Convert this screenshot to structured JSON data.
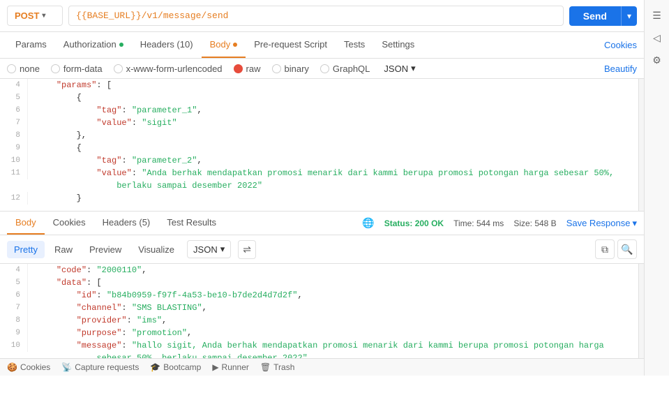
{
  "method": "POST",
  "url": "{{BASE_URL}}/v1/message/send",
  "send_label": "Send",
  "tabs": {
    "params": "Params",
    "authorization": "Authorization",
    "headers": "Headers (10)",
    "body": "Body",
    "pre_request": "Pre-request Script",
    "tests": "Tests",
    "settings": "Settings",
    "cookies": "Cookies"
  },
  "body_types": {
    "none": "none",
    "form_data": "form-data",
    "urlencoded": "x-www-form-urlencoded",
    "raw": "raw",
    "binary": "binary",
    "graphql": "GraphQL",
    "json": "JSON"
  },
  "beautify": "Beautify",
  "request_code": {
    "lines": [
      {
        "num": "4",
        "content": "    \"params\": ["
      },
      {
        "num": "5",
        "content": "        {"
      },
      {
        "num": "6",
        "content": "            \"tag\": \"parameter_1\","
      },
      {
        "num": "7",
        "content": "            \"value\": \"sigit\""
      },
      {
        "num": "8",
        "content": "        },"
      },
      {
        "num": "9",
        "content": "        {"
      },
      {
        "num": "10",
        "content": "            \"tag\": \"parameter_2\","
      },
      {
        "num": "11",
        "content": "            \"value\": \"Anda berhak mendapatkan promosi menarik dari kammi berupa promosi potongan harga sebesar 50%,\n                berlaku sampai desember 2022\""
      },
      {
        "num": "12",
        "content": "        }"
      }
    ]
  },
  "response_tabs": {
    "body": "Body",
    "cookies": "Cookies",
    "headers": "Headers (5)",
    "test_results": "Test Results"
  },
  "status": {
    "label": "Status: 200 OK",
    "time": "Time: 544 ms",
    "size": "Size: 548 B"
  },
  "save_response": "Save Response",
  "format_tabs": {
    "pretty": "Pretty",
    "raw": "Raw",
    "preview": "Preview",
    "visualize": "Visualize"
  },
  "response_code": {
    "lines": [
      {
        "num": "4",
        "content": "    \"code\": \"2000110\","
      },
      {
        "num": "5",
        "content": "    \"data\": ["
      },
      {
        "num": "6",
        "content": "        \"id\": \"b84b0959-f97f-4a53-be10-b7de2d4d7d2f\","
      },
      {
        "num": "7",
        "content": "        \"channel\": \"SMS BLASTING\","
      },
      {
        "num": "8",
        "content": "        \"provider\": \"ims\","
      },
      {
        "num": "9",
        "content": "        \"purpose\": \"promotion\","
      },
      {
        "num": "10",
        "content": "        \"message\": \"hallo sigit, Anda berhak mendapatkan promosi menarik dari kammi berupa promosi potongan harga\n            sebesar 50%, berlaku sampai desember 2022\""
      }
    ]
  },
  "bottom_bar": {
    "cookies": "Cookies",
    "capture": "Capture requests",
    "bootcamp": "Bootcamp",
    "runner": "Runner",
    "trash": "Trash"
  },
  "right_icons": [
    "☰",
    "◁",
    "⚙"
  ]
}
